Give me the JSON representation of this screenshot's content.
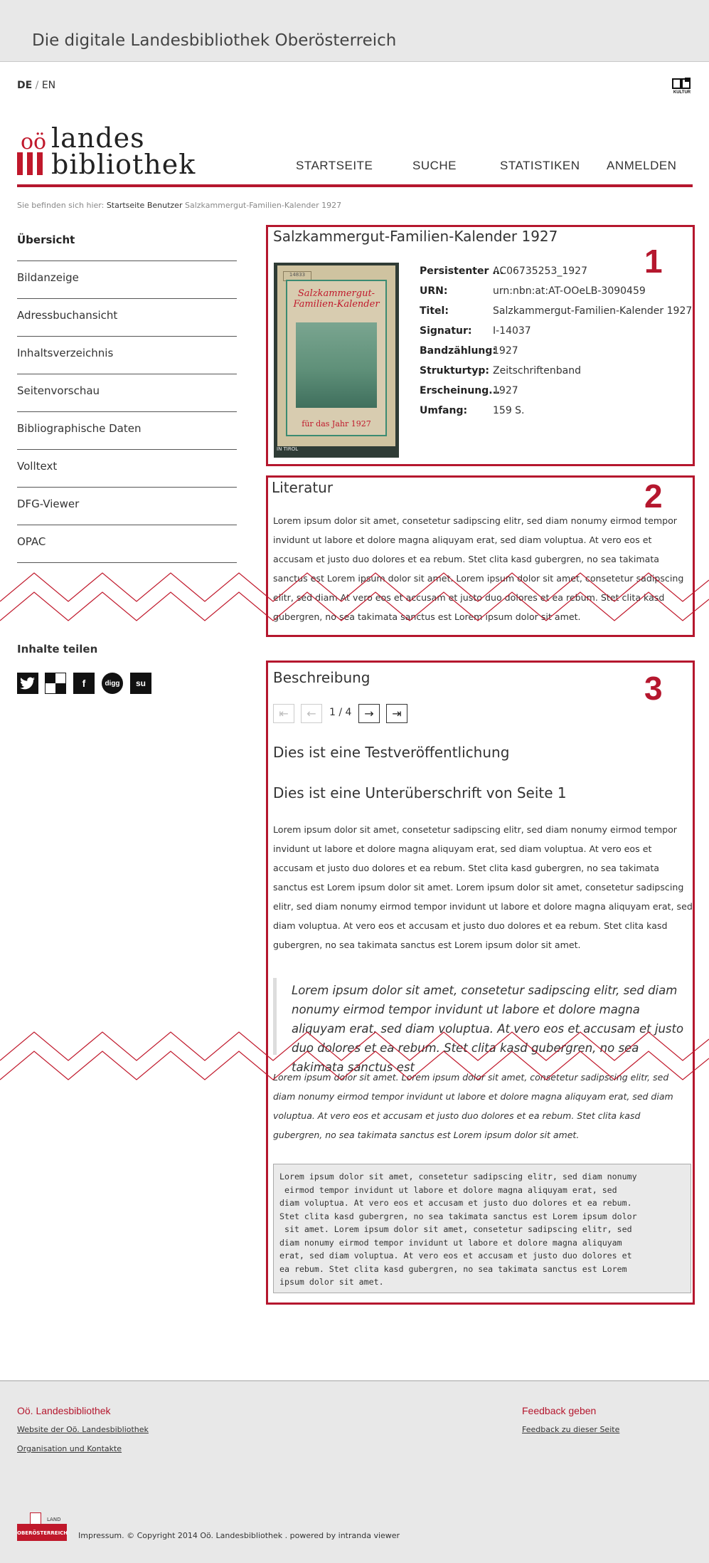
{
  "header": {
    "site_title": "Die digitale Landesbibliothek Oberösterreich",
    "lang_de": "DE",
    "lang_sep": "/",
    "lang_en": "EN",
    "kultur_label": "KULTUR"
  },
  "logo": {
    "oo": "oö",
    "line1": "landes",
    "line2": "bibliothek"
  },
  "nav": {
    "startseite": "STARTSEITE",
    "suche": "SUCHE",
    "statistiken": "STATISTIKEN",
    "anmelden": "ANMELDEN"
  },
  "breadcrumb": {
    "prefix": "Sie befinden sich hier:",
    "startseite": "Startseite",
    "benutzer": "Benutzer",
    "current": "Salzkammergut-Familien-Kalender 1927"
  },
  "sidebar": {
    "items": [
      {
        "label": "Übersicht"
      },
      {
        "label": "Bildanzeige"
      },
      {
        "label": "Adressbuchansicht"
      },
      {
        "label": "Inhaltsverzeichnis"
      },
      {
        "label": "Seitenvorschau"
      },
      {
        "label": "Bibliographische Daten"
      },
      {
        "label": "Volltext"
      },
      {
        "label": "DFG-Viewer"
      },
      {
        "label": "OPAC"
      }
    ],
    "share_title": "Inhalte teilen",
    "share_icons": [
      "twitter-icon",
      "delicious-icon",
      "facebook-icon",
      "digg-icon",
      "stumbleupon-icon"
    ],
    "share_glyphs": [
      "🐦",
      "",
      "f",
      "digg",
      "su"
    ]
  },
  "box1": {
    "number": "1",
    "title": "Salzkammergut-Familien-Kalender 1927",
    "cover": {
      "tag": "14833",
      "title": "Salzkammergut-Familien-Kalender",
      "year": "für das Jahr 1927",
      "footer": "IN TIROL"
    },
    "metadata": [
      {
        "label": "Persistenter ...",
        "value": "AC06735253_1927"
      },
      {
        "label": "URN:",
        "value": "urn:nbn:at:AT-OOeLB-3090459"
      },
      {
        "label": "Titel:",
        "value": "Salzkammergut-Familien-Kalender 1927"
      },
      {
        "label": "Signatur:",
        "value": "I-14037"
      },
      {
        "label": "Bandzählung:",
        "value": "1927"
      },
      {
        "label": "Strukturtyp:",
        "value": "Zeitschriftenband"
      },
      {
        "label": "Erscheinung...",
        "value": "1927"
      },
      {
        "label": "Umfang:",
        "value": "159 S."
      }
    ]
  },
  "box2": {
    "number": "2",
    "title": "Literatur",
    "text": "Lorem ipsum dolor sit amet, consetetur sadipscing elitr, sed diam nonumy eirmod tempor invidunt ut labore et dolore magna aliquyam erat, sed diam voluptua. At vero eos et accusam et justo duo dolores et ea rebum. Stet clita kasd gubergren, no sea takimata sanctus est Lorem ipsum dolor sit amet. Lorem ipsum dolor sit amet, consetetur sadipscing elitr, sed diam At vero eos et accusam et justo duo dolores et ea rebum. Stet clita kasd gubergren, no sea takimata sanctus est Lorem ipsum dolor sit amet."
  },
  "box3": {
    "number": "3",
    "title": "Beschreibung",
    "pager": {
      "first": "⇤",
      "prev": "←",
      "status": "1 / 4",
      "next": "→",
      "last": "⇥"
    },
    "heading": "Dies ist eine Testveröffentlichung",
    "subheading": "Dies ist eine Unterüberschrift von Seite 1",
    "paragraph": "Lorem ipsum dolor sit amet, consetetur sadipscing elitr, sed diam nonumy eirmod tempor invidunt ut labore et dolore magna aliquyam erat, sed diam voluptua. At vero eos et accusam et justo duo dolores et ea rebum. Stet clita kasd gubergren, no sea takimata sanctus est Lorem ipsum dolor sit amet. Lorem ipsum dolor sit amet, consetetur sadipscing elitr, sed diam nonumy eirmod tempor invidunt ut labore et dolore magna aliquyam erat, sed diam voluptua. At vero eos et accusam et justo duo dolores et ea rebum. Stet clita kasd gubergren, no sea takimata sanctus est Lorem ipsum dolor sit amet.",
    "quote": "Lorem ipsum dolor sit amet, consetetur sadipscing elitr, sed diam nonumy eirmod tempor invidunt ut labore et dolore magna aliquyam erat, sed diam voluptua. At vero eos et accusam et justo duo dolores et ea rebum. Stet clita kasd gubergren, no sea takimata sanctus est",
    "italic_paragraph": "Lorem ipsum dolor sit amet. Lorem ipsum dolor sit amet, consetetur sadipscing elitr, sed diam nonumy eirmod tempor invidunt ut labore et dolore magna aliquyam erat, sed diam voluptua. At vero eos et accusam et justo duo dolores et ea rebum. Stet clita kasd gubergren, no sea takimata sanctus est Lorem ipsum dolor sit amet.",
    "preformatted": "Lorem ipsum dolor sit amet, consetetur sadipscing elitr, sed diam nonumy\n eirmod tempor invidunt ut labore et dolore magna aliquyam erat, sed\ndiam voluptua. At vero eos et accusam et justo duo dolores et ea rebum.\nStet clita kasd gubergren, no sea takimata sanctus est Lorem ipsum dolor\n sit amet. Lorem ipsum dolor sit amet, consetetur sadipscing elitr, sed\ndiam nonumy eirmod tempor invidunt ut labore et dolore magna aliquyam\nerat, sed diam voluptua. At vero eos et accusam et justo duo dolores et\nea rebum. Stet clita kasd gubergren, no sea takimata sanctus est Lorem\nipsum dolor sit amet."
  },
  "footer": {
    "col1_title": "Oö. Landesbibliothek",
    "col1_link1": "Website der Oö. Landesbibliothek",
    "col1_link2": "Organisation und Kontakte",
    "col2_title": "Feedback geben",
    "col2_link1": "Feedback zu dieser Seite",
    "land_logo_top": "LAND",
    "land_logo_bottom": "OBERÖSTERREICH",
    "impressum": "Impressum",
    "copyright": ". © Copyright 2014 Oö. Landesbibliothek . powered by ",
    "intranda": "intranda viewer"
  },
  "colors": {
    "accent": "#b5172e",
    "banner_bg": "#e8e8e8",
    "footer_bg": "#e8e8e8"
  }
}
